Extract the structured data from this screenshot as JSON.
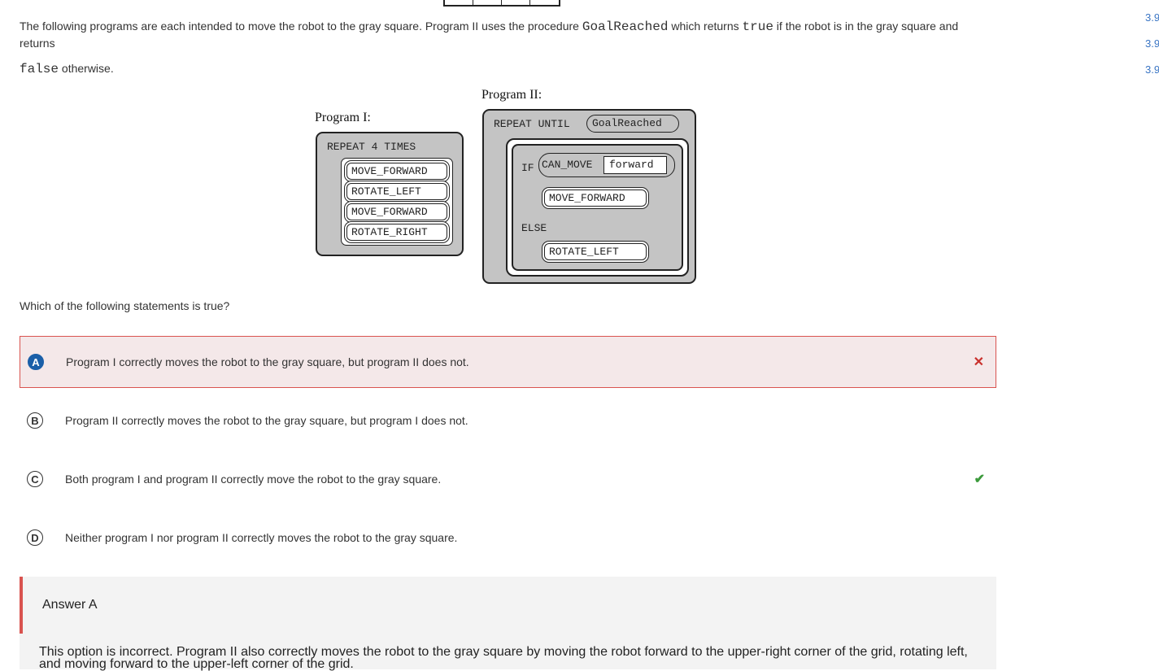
{
  "right_margin": [
    "3.9",
    "3.9",
    "3.9"
  ],
  "intro": {
    "part1": "The following programs are each intended to move the robot to the gray square. Program II uses the procedure ",
    "code1": "GoalReached",
    "part2": " which returns ",
    "code2": "true",
    "part3": " if the robot is in the gray square and returns",
    "code3": "false",
    "part4": " otherwise."
  },
  "program1": {
    "label": "Program I:",
    "repeat": "REPEAT 4 TIMES",
    "commands": [
      "MOVE_FORWARD",
      "ROTATE_LEFT",
      "MOVE_FORWARD",
      "ROTATE_RIGHT"
    ]
  },
  "program2": {
    "label": "Program II:",
    "repeat_until": "REPEAT UNTIL",
    "condition": "GoalReached",
    "if": "IF",
    "can_move": "CAN_MOVE",
    "direction": "forward",
    "then_cmd": "MOVE_FORWARD",
    "else": "ELSE",
    "else_cmd": "ROTATE_LEFT"
  },
  "question": "Which of the following statements is true?",
  "options": [
    {
      "letter": "A",
      "text": "Program I correctly moves the robot to the gray square, but program II does not.",
      "state": "selected-incorrect",
      "icon": "x-icon"
    },
    {
      "letter": "B",
      "text": "Program II correctly moves the robot to the gray square, but program I does not.",
      "state": "none"
    },
    {
      "letter": "C",
      "text": "Both program I and program II correctly move the robot to the gray square.",
      "state": "correct",
      "icon": "check-icon"
    },
    {
      "letter": "D",
      "text": "Neither program I nor program II correctly moves the robot to the gray square.",
      "state": "none"
    }
  ],
  "answer": {
    "title": "Answer A",
    "explanation": "This option is incorrect. Program II also correctly moves the robot to the gray square by moving the robot forward to the upper-right corner of the grid, rotating left, and moving forward to the upper-left corner of the grid."
  },
  "colors": {
    "selected_bg": "#f4e8e9",
    "incorrect": "#d9534f",
    "correct": "#3c9a3c",
    "accent": "#1a5fa8",
    "block_gray": "#c4c4c4",
    "link": "#3a75c4"
  }
}
